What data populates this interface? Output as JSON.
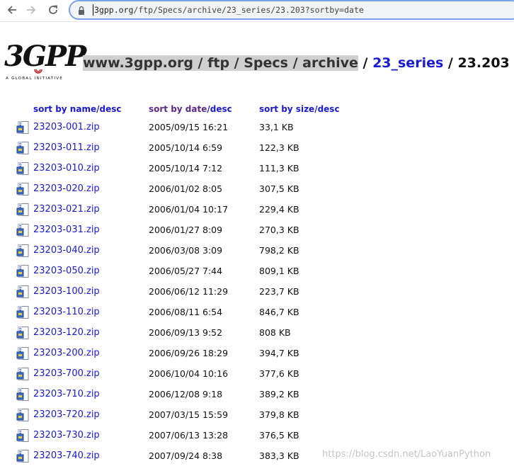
{
  "browser": {
    "url_host": "3gpp.org",
    "url_path": "/ftp/Specs/archive/23_series/23.203?sortby=date"
  },
  "logo": {
    "text": "3GPP",
    "tagline": "A GLOBAL INITIATIVE"
  },
  "breadcrumb": {
    "part1": "www.3gpp.org / ftp / Specs / archive",
    "sep1": " / ",
    "part2": "23_series",
    "sep2": " / ",
    "part3": "23.203"
  },
  "headers": {
    "name_sort": "sort by name",
    "name_desc": "desc",
    "date_sort": "sort by date",
    "date_desc": "desc",
    "size_sort": "sort by size",
    "size_desc": "desc",
    "slash": "/"
  },
  "files": [
    {
      "name": "23203-001.zip",
      "date": "2005/09/15 16:21",
      "size": "33,1 KB"
    },
    {
      "name": "23203-011.zip",
      "date": "2005/10/14 6:59",
      "size": "122,3 KB"
    },
    {
      "name": "23203-010.zip",
      "date": "2005/10/14 7:12",
      "size": "111,3 KB"
    },
    {
      "name": "23203-020.zip",
      "date": "2006/01/02 8:05",
      "size": "307,5 KB"
    },
    {
      "name": "23203-021.zip",
      "date": "2006/01/04 10:17",
      "size": "229,4 KB"
    },
    {
      "name": "23203-031.zip",
      "date": "2006/01/27 8:09",
      "size": "270,3 KB"
    },
    {
      "name": "23203-040.zip",
      "date": "2006/03/08 3:09",
      "size": "798,2 KB"
    },
    {
      "name": "23203-050.zip",
      "date": "2006/05/27 7:44",
      "size": "809,1 KB"
    },
    {
      "name": "23203-100.zip",
      "date": "2006/06/12 11:29",
      "size": "223,7 KB"
    },
    {
      "name": "23203-110.zip",
      "date": "2006/08/11 6:54",
      "size": "846,7 KB"
    },
    {
      "name": "23203-120.zip",
      "date": "2006/09/13 9:52",
      "size": "808 KB"
    },
    {
      "name": "23203-200.zip",
      "date": "2006/09/26 18:29",
      "size": "394,7 KB"
    },
    {
      "name": "23203-700.zip",
      "date": "2006/10/04 10:16",
      "size": "377,6 KB"
    },
    {
      "name": "23203-710.zip",
      "date": "2006/12/08 9:18",
      "size": "389,2 KB"
    },
    {
      "name": "23203-720.zip",
      "date": "2007/03/15 15:59",
      "size": "379,8 KB"
    },
    {
      "name": "23203-730.zip",
      "date": "2007/06/13 13:28",
      "size": "376,5 KB"
    },
    {
      "name": "23203-740.zip",
      "date": "2007/09/24 8:38",
      "size": "383,3 KB"
    }
  ],
  "watermark": "https://blog.csdn.net/LaoYuanPython",
  "colors": {
    "link": "#1a1ad0",
    "visited": "#5b2a86",
    "highlight": "#cfcfcf"
  }
}
